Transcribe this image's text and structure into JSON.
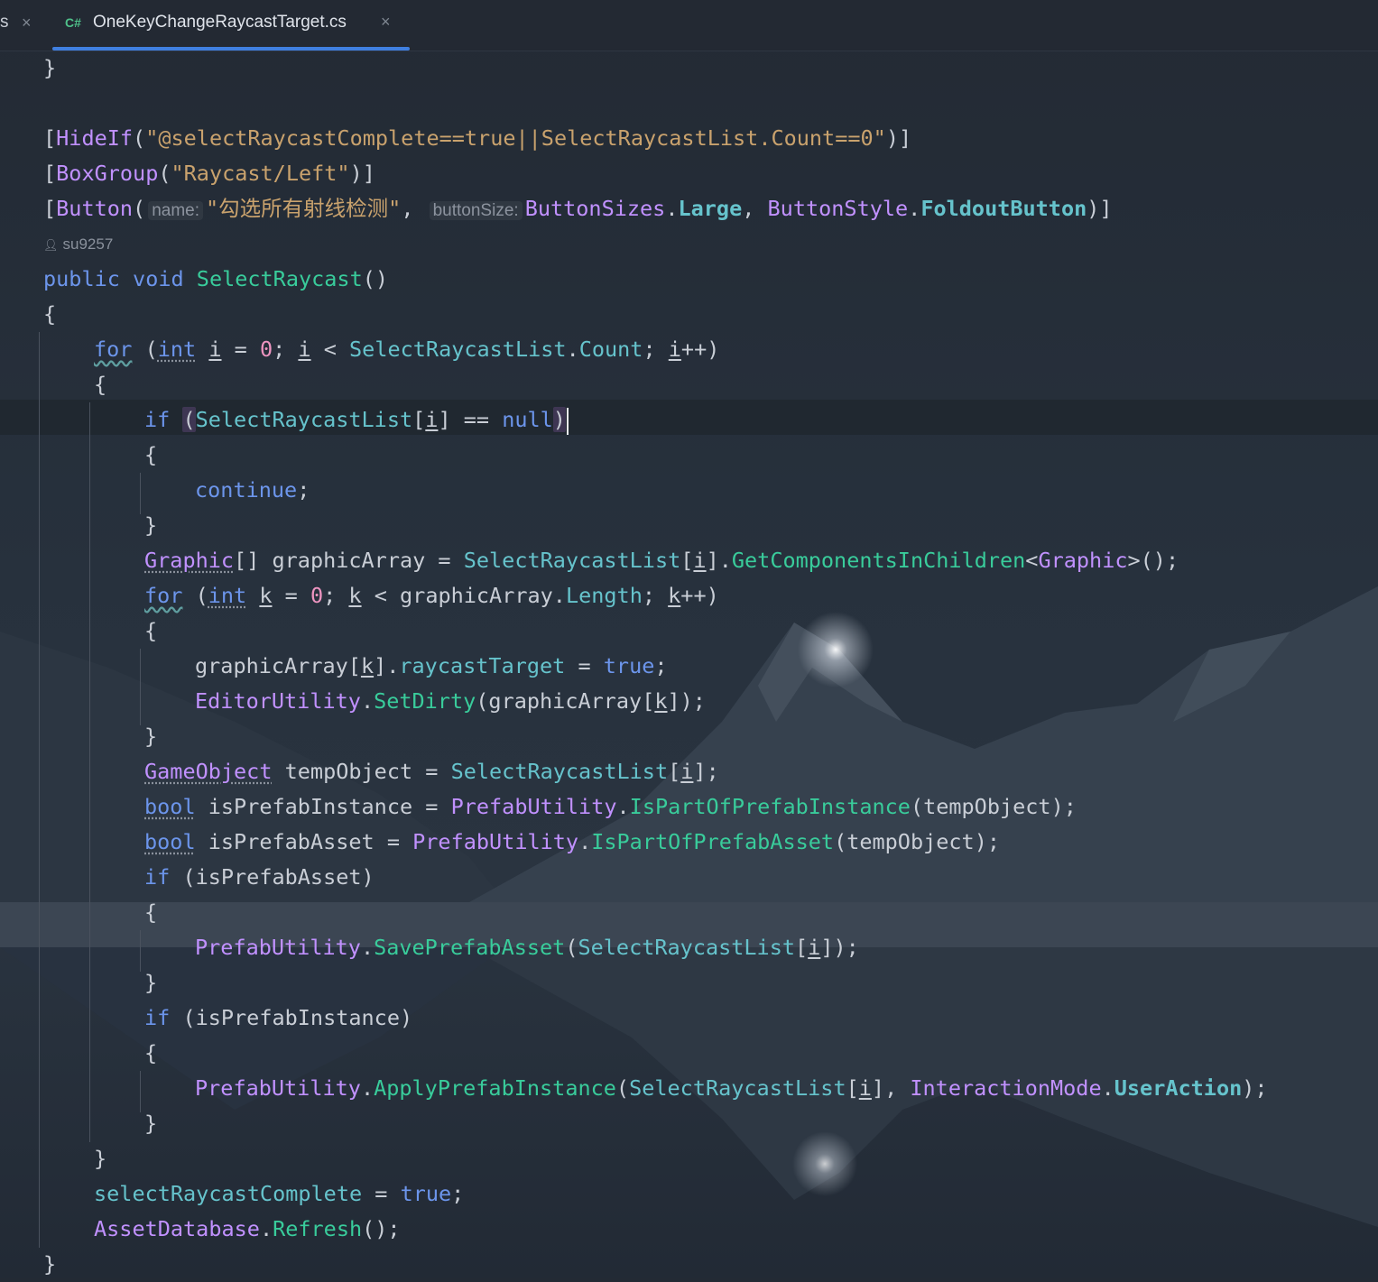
{
  "tabs": {
    "previous": {
      "fragment": "s",
      "close_glyph": "×"
    },
    "active": {
      "lang_badge": "C#",
      "filename": "OneKeyChangeRaycastTarget.cs",
      "close_glyph": "×"
    }
  },
  "editor": {
    "author_lens": "su9257",
    "inlay_hints": {
      "name": "name:",
      "buttonSize": "buttonSize:"
    },
    "attributes": {
      "hide_if_condition": "\"@selectRaycastComplete==true||SelectRaycastList.Count==0\"",
      "box_group": "\"Raycast/Left\"",
      "button_label": "\"勾选所有射线检测\""
    },
    "method_name": "SelectRaycast",
    "identifiers": {
      "list": "SelectRaycastList",
      "graphic_array": "graphicArray",
      "temp_object": "tempObject",
      "is_prefab_instance": "isPrefabInstance",
      "is_prefab_asset": "isPrefabAsset",
      "complete_flag": "selectRaycastComplete"
    }
  },
  "colors": {
    "keyword": "#6c95eb",
    "type": "#c191ff",
    "method": "#39cc9b",
    "property": "#66c3cc",
    "string": "#c9a26d",
    "number": "#ed94c0",
    "tab_underline": "#3f7fe0"
  }
}
